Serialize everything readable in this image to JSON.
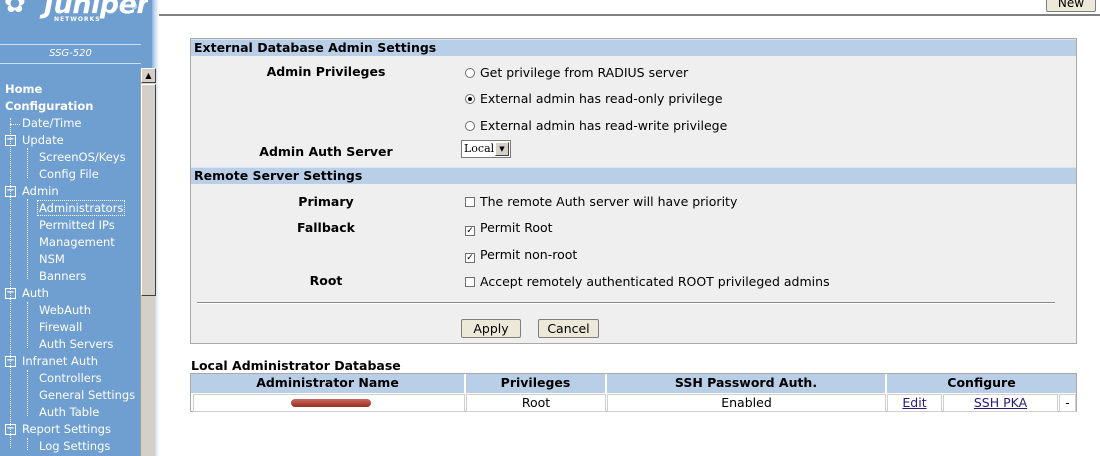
{
  "brand": {
    "logo_text": "Juniper",
    "logo_sub": "NETWORKS",
    "logo_reg": "®",
    "model": "SSG-520"
  },
  "toolbar": {
    "new_label": "New"
  },
  "nav": {
    "items": [
      {
        "label": "Home",
        "level": 0
      },
      {
        "label": "Configuration",
        "level": 0
      },
      {
        "label": "Date/Time",
        "level": 1
      },
      {
        "label": "Update",
        "level": 1,
        "expandable": true
      },
      {
        "label": "ScreenOS/Keys",
        "level": 2
      },
      {
        "label": "Config File",
        "level": 2
      },
      {
        "label": "Admin",
        "level": 1,
        "expandable": true
      },
      {
        "label": "Administrators",
        "level": 2,
        "selected": true
      },
      {
        "label": "Permitted IPs",
        "level": 2
      },
      {
        "label": "Management",
        "level": 2
      },
      {
        "label": "NSM",
        "level": 2
      },
      {
        "label": "Banners",
        "level": 2
      },
      {
        "label": "Auth",
        "level": 1,
        "expandable": true
      },
      {
        "label": "WebAuth",
        "level": 2
      },
      {
        "label": "Firewall",
        "level": 2
      },
      {
        "label": "Auth Servers",
        "level": 2
      },
      {
        "label": "Infranet Auth",
        "level": 1,
        "expandable": true
      },
      {
        "label": "Controllers",
        "level": 2
      },
      {
        "label": "General Settings",
        "level": 2
      },
      {
        "label": "Auth Table",
        "level": 2
      },
      {
        "label": "Report Settings",
        "level": 1,
        "expandable": true
      },
      {
        "label": "Log Settings",
        "level": 2
      }
    ],
    "expander_symbol": "−"
  },
  "external": {
    "title": "External Database Admin Settings",
    "privileges_label": "Admin Privileges",
    "privilege_options": [
      {
        "label": "Get privilege from RADIUS server",
        "selected": false
      },
      {
        "label": "External admin has read-only privilege",
        "selected": true
      },
      {
        "label": "External admin has read-write privilege",
        "selected": false
      }
    ],
    "auth_server_label": "Admin Auth Server",
    "auth_server_value": "Local"
  },
  "remote": {
    "title": "Remote Server Settings",
    "primary_label": "Primary",
    "primary_option": {
      "label": "The remote Auth server will have priority",
      "checked": false
    },
    "fallback_label": "Fallback",
    "fallback_options": [
      {
        "label": "Permit Root",
        "checked": true
      },
      {
        "label": "Permit non-root",
        "checked": true
      }
    ],
    "root_label": "Root",
    "root_option": {
      "label": "Accept remotely authenticated ROOT privileged admins",
      "checked": false
    }
  },
  "actions": {
    "apply_label": "Apply",
    "cancel_label": "Cancel"
  },
  "local_db": {
    "title": "Local Administrator Database",
    "columns": [
      "Administrator Name",
      "Privileges",
      "SSH Password Auth.",
      "Configure"
    ],
    "rows": [
      {
        "name_redacted": true,
        "privileges": "Root",
        "ssh_password_auth": "Enabled",
        "edit_label": "Edit",
        "ssh_pka_label": "SSH PKA",
        "extra": "-"
      }
    ]
  },
  "colors": {
    "sidebar": "#6f9ed1",
    "section_header": "#b9cfe8",
    "panel_bg": "#efefef",
    "redaction": "#b24437"
  }
}
